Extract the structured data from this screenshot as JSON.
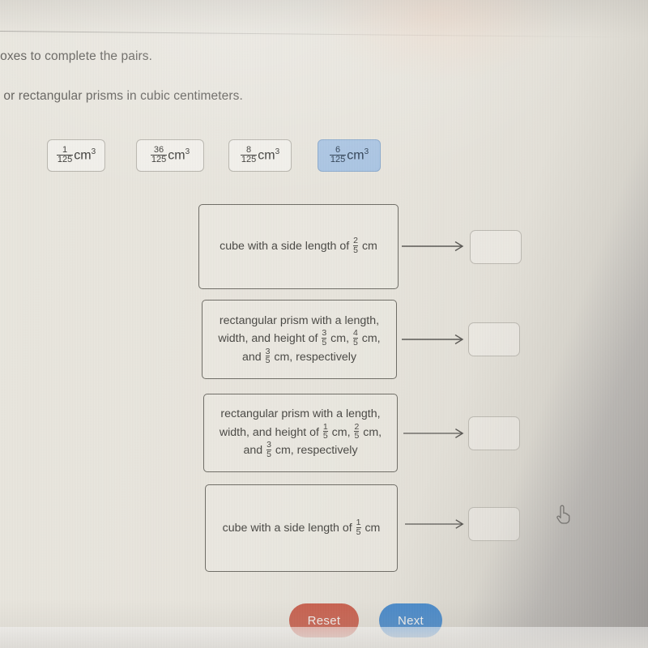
{
  "instructions": {
    "line1": "ect boxes to complete the pairs.",
    "line2": "ubes or rectangular prisms in cubic centimeters."
  },
  "tiles": [
    {
      "numerator": "1",
      "denominator": "125",
      "unit": "cm",
      "exponent": "3",
      "selected": false
    },
    {
      "numerator": "36",
      "denominator": "125",
      "unit": "cm",
      "exponent": "3",
      "selected": false
    },
    {
      "numerator": "8",
      "denominator": "125",
      "unit": "cm",
      "exponent": "3",
      "selected": false
    },
    {
      "numerator": "6",
      "denominator": "125",
      "unit": "cm",
      "exponent": "3",
      "selected": true
    }
  ],
  "pairs": [
    {
      "kind": "cube",
      "lines": [
        {
          "pre": "cube with a side length of ",
          "frac": {
            "num": "2",
            "den": "5"
          },
          "post": " cm"
        }
      ],
      "answer": ""
    },
    {
      "kind": "prism",
      "lines": [
        {
          "pre": "rectangular prism with a length,",
          "frac": null,
          "post": ""
        },
        {
          "pre": "width, and height of ",
          "frac": {
            "num": "3",
            "den": "5"
          },
          "mid": " cm, ",
          "frac2": {
            "num": "4",
            "den": "5"
          },
          "post": " cm,"
        },
        {
          "pre": "and ",
          "frac": {
            "num": "3",
            "den": "5"
          },
          "post": " cm, respectively"
        }
      ],
      "answer": ""
    },
    {
      "kind": "prism",
      "lines": [
        {
          "pre": "rectangular prism with a length,",
          "frac": null,
          "post": ""
        },
        {
          "pre": "width, and height of ",
          "frac": {
            "num": "1",
            "den": "5"
          },
          "mid": " cm, ",
          "frac2": {
            "num": "2",
            "den": "5"
          },
          "post": " cm,"
        },
        {
          "pre": "and ",
          "frac": {
            "num": "3",
            "den": "5"
          },
          "post": " cm, respectively"
        }
      ],
      "answer": ""
    },
    {
      "kind": "cube",
      "lines": [
        {
          "pre": "cube with a side length of ",
          "frac": {
            "num": "1",
            "den": "5"
          },
          "post": " cm"
        }
      ],
      "answer": ""
    }
  ],
  "buttons": {
    "reset": "Reset",
    "next": "Next"
  },
  "colors": {
    "reset_bg": "#c8614f",
    "next_bg": "#4a8ac9",
    "tile_selected_bg": "#a9c4e2",
    "page_bg": "#e7e4dc",
    "text": "#4a4945",
    "box_border": "#6f6d66"
  },
  "cursor": {
    "icon": "pointing-hand-cursor"
  }
}
